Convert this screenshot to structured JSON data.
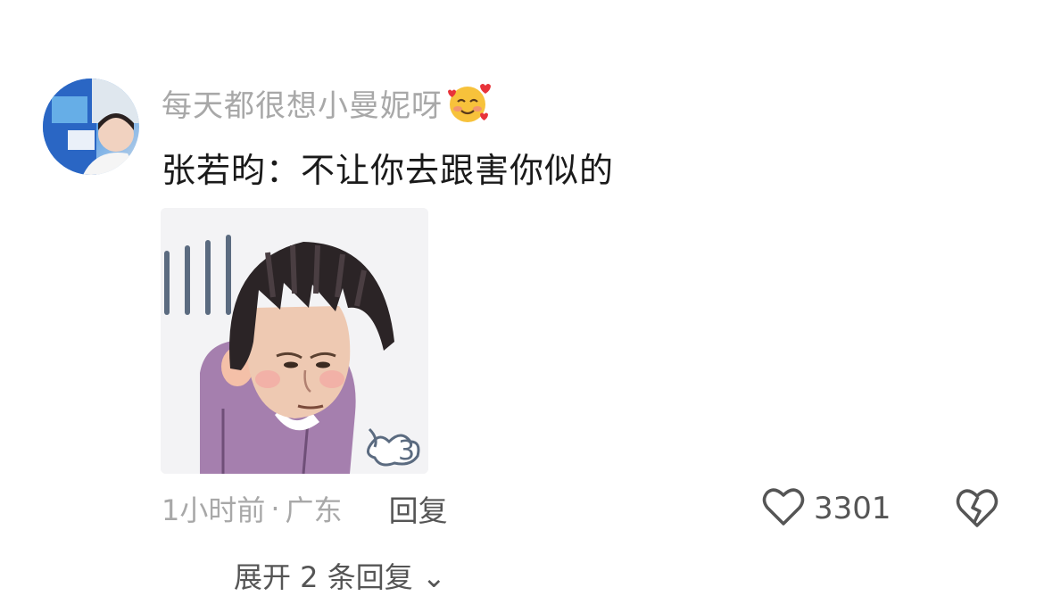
{
  "comment": {
    "username": "每天都很想小曼妮呀",
    "username_emoji": "smiling-face-with-hearts-icon",
    "text": "张若昀：不让你去跟害你似的",
    "sticker": "cartoon-girl-sighing-sticker",
    "meta": {
      "time": "1小时前",
      "separator": "·",
      "location": "广东"
    },
    "reply_label": "回复",
    "like_count": "3301",
    "expand_replies_label": "展开 2 条回复 ⌄"
  },
  "colors": {
    "muted_text": "#a8a8a8",
    "body_text": "#1a1a1a",
    "action_text": "#555555",
    "sticker_shirt": "#a57fae",
    "sticker_hair": "#2b2426"
  }
}
